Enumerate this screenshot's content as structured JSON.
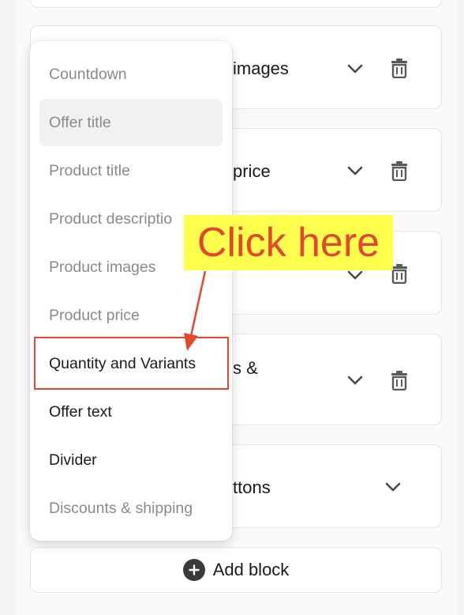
{
  "cards": [
    {
      "title": "",
      "has_chevron": false,
      "has_trash": false
    },
    {
      "title": "images",
      "has_chevron": true,
      "has_trash": true
    },
    {
      "title": "price",
      "has_chevron": true,
      "has_trash": true
    },
    {
      "title": "",
      "has_chevron": true,
      "has_trash": true
    },
    {
      "title": "s &",
      "has_chevron": true,
      "has_trash": true
    },
    {
      "title": "ttons",
      "has_chevron": true,
      "has_trash": false
    }
  ],
  "add_block": {
    "label": "Add block",
    "icon": "plus-circle-icon"
  },
  "menu": {
    "items": [
      {
        "label": "Countdown",
        "state": "disabled"
      },
      {
        "label": "Offer title",
        "state": "disabled-hover"
      },
      {
        "label": "Product title",
        "state": "disabled"
      },
      {
        "label": "Product descriptio",
        "state": "disabled"
      },
      {
        "label": "Product images",
        "state": "disabled"
      },
      {
        "label": "Product price",
        "state": "disabled"
      },
      {
        "label": "Quantity and Variants",
        "state": "enabled"
      },
      {
        "label": "Offer text",
        "state": "enabled"
      },
      {
        "label": "Divider",
        "state": "enabled"
      },
      {
        "label": "Discounts & shipping",
        "state": "disabled"
      }
    ]
  },
  "annotation": {
    "text": "Click here",
    "color": "#e4472f",
    "highlight": "#ffff4d"
  },
  "icons": {
    "chevron": "chevron-down-icon",
    "trash": "trash-icon"
  }
}
